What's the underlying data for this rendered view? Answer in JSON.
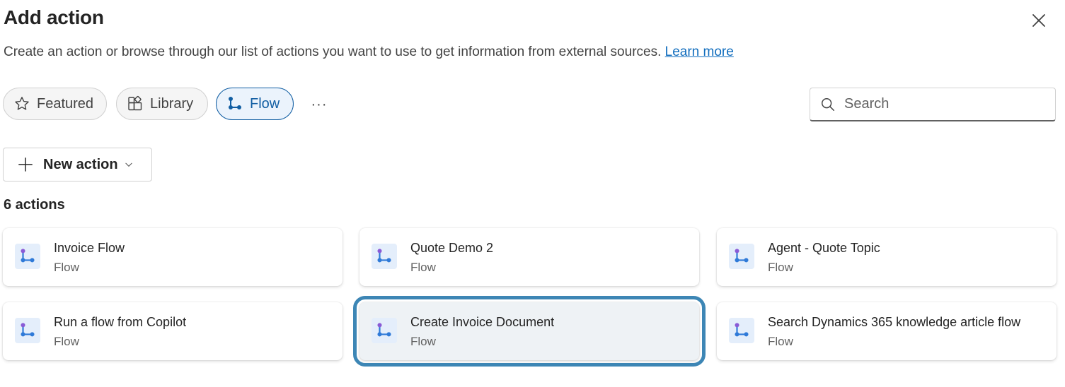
{
  "dialog": {
    "title": "Add action",
    "description": "Create an action or browse through our list of actions you want to use to get information from external sources.",
    "learn_more": "Learn more"
  },
  "filters": {
    "tabs": [
      {
        "label": "Featured",
        "icon": "star-icon",
        "active": false
      },
      {
        "label": "Library",
        "icon": "library-icon",
        "active": false
      },
      {
        "label": "Flow",
        "icon": "flow-icon",
        "active": true
      }
    ],
    "more_label": "···"
  },
  "search": {
    "placeholder": "Search",
    "value": ""
  },
  "toolbar": {
    "new_action_label": "New action"
  },
  "actions_count_label": "6 actions",
  "actions": [
    {
      "title": "Invoice Flow",
      "type": "Flow",
      "selected": false
    },
    {
      "title": "Quote Demo 2",
      "type": "Flow",
      "selected": false
    },
    {
      "title": "Agent - Quote Topic",
      "type": "Flow",
      "selected": false
    },
    {
      "title": "Run a flow from Copilot",
      "type": "Flow",
      "selected": false
    },
    {
      "title": "Create Invoice Document",
      "type": "Flow",
      "selected": true
    },
    {
      "title": "Search Dynamics 365 knowledge article flow",
      "type": "Flow",
      "selected": false
    }
  ],
  "colors": {
    "accent": "#115ea3",
    "link": "#0f6cbd",
    "selection_outline": "#3d86b5",
    "flow_icon_purple": "#8a5bd6",
    "flow_icon_blue": "#2f7ad8"
  }
}
